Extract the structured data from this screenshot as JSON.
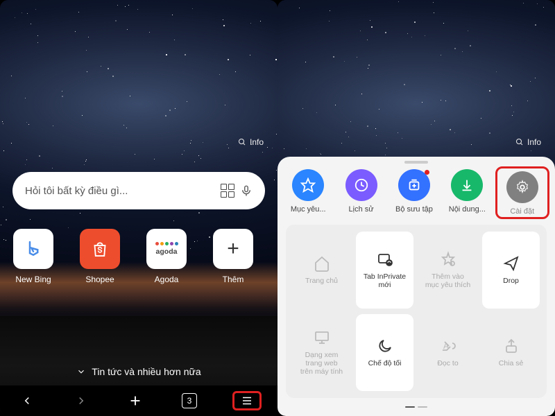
{
  "left": {
    "info_label": "Info",
    "search_placeholder": "Hỏi tôi bất kỳ điều gì...",
    "shortcuts": [
      {
        "label": "New Bing"
      },
      {
        "label": "Shopee"
      },
      {
        "label": "Agoda",
        "text": "agoda"
      },
      {
        "label": "Thêm",
        "glyph": "+"
      }
    ],
    "newsfeed": "Tin tức và nhiều hơn nữa",
    "tab_count": "3"
  },
  "right": {
    "info_label": "Info",
    "circles": [
      {
        "label": "Mục yêu...",
        "color": "#2a85ff"
      },
      {
        "label": "Lịch sử",
        "color": "#7a5cff"
      },
      {
        "label": "Bộ sưu tập",
        "color": "#3371ff",
        "dot": true
      },
      {
        "label": "Nội dung...",
        "color": "#17b86a"
      },
      {
        "label": "Cài đặt",
        "color": "#808080"
      }
    ],
    "grid": [
      {
        "label": "Trang chủ",
        "state": "disabled"
      },
      {
        "label": "Tab InPrivate\nmới",
        "state": "active"
      },
      {
        "label": "Thêm vào\nmục yêu thích",
        "state": "disabled"
      },
      {
        "label": "Drop",
        "state": "active"
      },
      {
        "label": "Dạng xem\ntrang web\ntrên máy tính",
        "state": "disabled"
      },
      {
        "label": "Chế độ tối",
        "state": "active"
      },
      {
        "label": "Đọc to",
        "state": "disabled"
      },
      {
        "label": "Chia sẻ",
        "state": "disabled"
      }
    ]
  }
}
